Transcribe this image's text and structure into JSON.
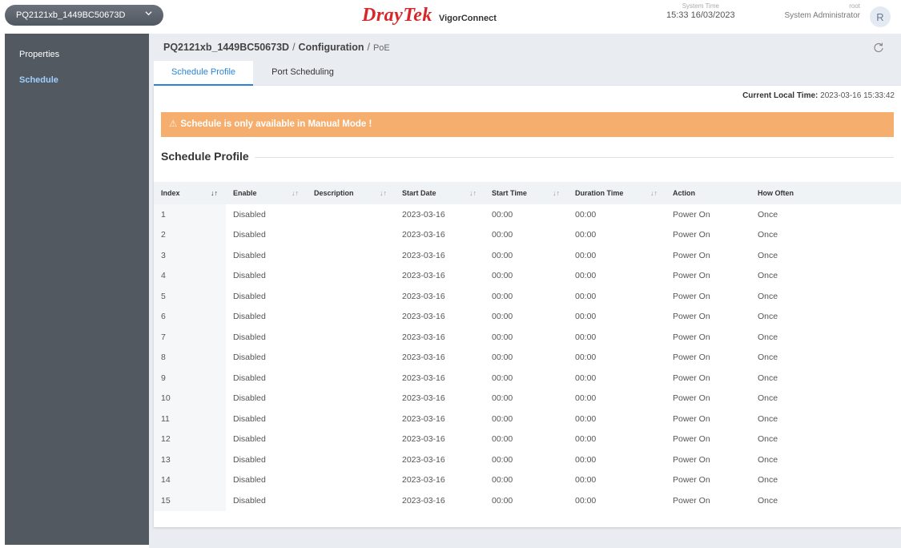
{
  "header": {
    "device_name": "PQ2121xb_1449BC50673D",
    "brand": "DrayTek",
    "product": "VigorConnect",
    "system_time_label": "System Time",
    "system_time": "15:33 16/03/2023",
    "user_label": "root",
    "user_role": "System Administrator",
    "avatar_letter": "R"
  },
  "sidebar": {
    "items": [
      {
        "label": "Properties",
        "active": false
      },
      {
        "label": "Schedule",
        "active": true
      }
    ]
  },
  "breadcrumb": {
    "device": "PQ2121xb_1449BC50673D",
    "section": "Configuration",
    "page": "PoE"
  },
  "tabs": [
    {
      "label": "Schedule Profile",
      "active": true
    },
    {
      "label": "Port Scheduling",
      "active": false
    }
  ],
  "current_time": {
    "label": "Current Local Time:",
    "value": "2023-03-16 15:33:42"
  },
  "warning": "Schedule is only available in Manual Mode !",
  "section_title": "Schedule Profile",
  "table": {
    "columns": [
      "Index",
      "Enable",
      "Description",
      "Start Date",
      "Start Time",
      "Duration Time",
      "Action",
      "How Often"
    ],
    "rows": [
      [
        "1",
        "Disabled",
        "",
        "2023-03-16",
        "00:00",
        "00:00",
        "Power On",
        "Once"
      ],
      [
        "2",
        "Disabled",
        "",
        "2023-03-16",
        "00:00",
        "00:00",
        "Power On",
        "Once"
      ],
      [
        "3",
        "Disabled",
        "",
        "2023-03-16",
        "00:00",
        "00:00",
        "Power On",
        "Once"
      ],
      [
        "4",
        "Disabled",
        "",
        "2023-03-16",
        "00:00",
        "00:00",
        "Power On",
        "Once"
      ],
      [
        "5",
        "Disabled",
        "",
        "2023-03-16",
        "00:00",
        "00:00",
        "Power On",
        "Once"
      ],
      [
        "6",
        "Disabled",
        "",
        "2023-03-16",
        "00:00",
        "00:00",
        "Power On",
        "Once"
      ],
      [
        "7",
        "Disabled",
        "",
        "2023-03-16",
        "00:00",
        "00:00",
        "Power On",
        "Once"
      ],
      [
        "8",
        "Disabled",
        "",
        "2023-03-16",
        "00:00",
        "00:00",
        "Power On",
        "Once"
      ],
      [
        "9",
        "Disabled",
        "",
        "2023-03-16",
        "00:00",
        "00:00",
        "Power On",
        "Once"
      ],
      [
        "10",
        "Disabled",
        "",
        "2023-03-16",
        "00:00",
        "00:00",
        "Power On",
        "Once"
      ],
      [
        "11",
        "Disabled",
        "",
        "2023-03-16",
        "00:00",
        "00:00",
        "Power On",
        "Once"
      ],
      [
        "12",
        "Disabled",
        "",
        "2023-03-16",
        "00:00",
        "00:00",
        "Power On",
        "Once"
      ],
      [
        "13",
        "Disabled",
        "",
        "2023-03-16",
        "00:00",
        "00:00",
        "Power On",
        "Once"
      ],
      [
        "14",
        "Disabled",
        "",
        "2023-03-16",
        "00:00",
        "00:00",
        "Power On",
        "Once"
      ],
      [
        "15",
        "Disabled",
        "",
        "2023-03-16",
        "00:00",
        "00:00",
        "Power On",
        "Once"
      ]
    ]
  },
  "colors": {
    "brand_red": "#d8262a",
    "accent_blue": "#2b85d9",
    "warning_orange": "#f6ae6e",
    "sidebar_bg": "#525961"
  }
}
